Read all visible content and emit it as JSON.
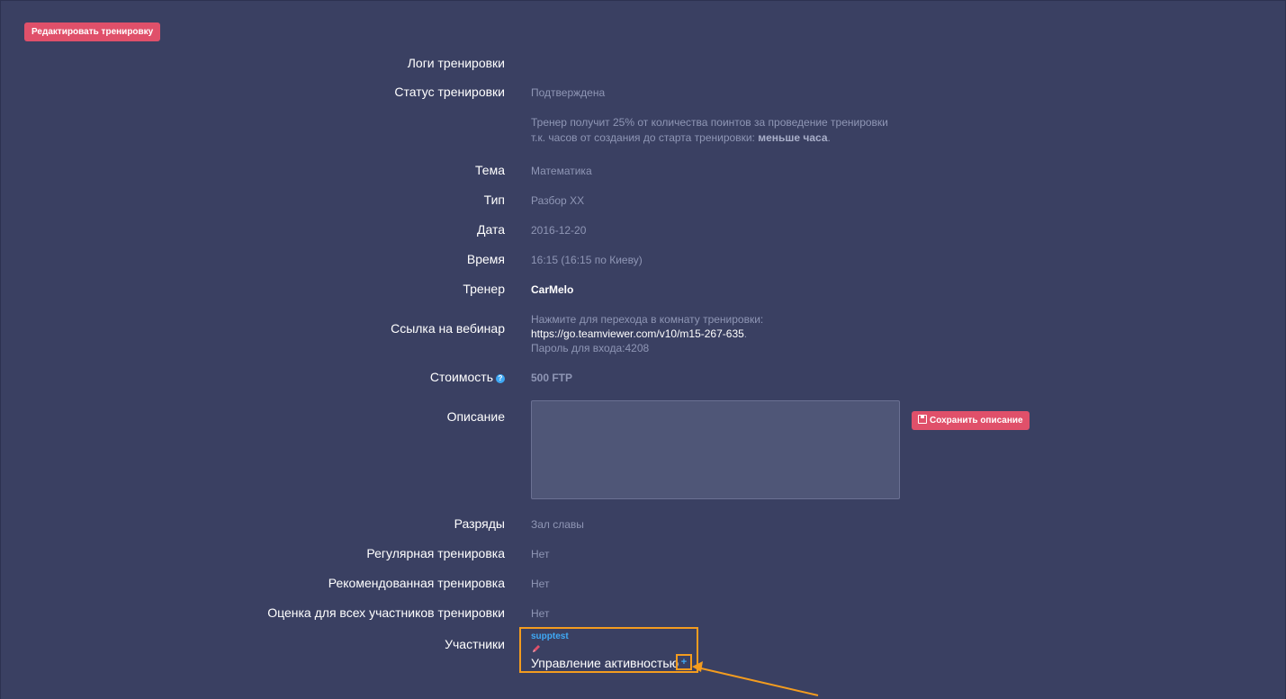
{
  "edit_button_label": "Редактировать тренировку",
  "fields": {
    "logs": {
      "label": "Логи тренировки",
      "value": ""
    },
    "status": {
      "label": "Статус тренировки",
      "value": "Подтверждена"
    },
    "status_note": {
      "line1": "Тренер получит 25% от количества поинтов за проведение тренировки",
      "line2_prefix": "т.к. часов от создания до старта тренировки: ",
      "line2_bold": "меньше часа",
      "line2_suffix": "."
    },
    "topic": {
      "label": "Тема",
      "value": "Математика"
    },
    "type": {
      "label": "Тип",
      "value": "Разбор XX"
    },
    "date": {
      "label": "Дата",
      "value": "2016-12-20"
    },
    "time": {
      "label": "Время",
      "value": "16:15 (16:15 по Киеву)"
    },
    "trainer": {
      "label": "Тренер",
      "value": "CarMelo"
    },
    "webinar": {
      "label": "Ссылка на вебинар",
      "line1": "Нажмите для перехода в комнату тренировки:",
      "link": "https://go.teamviewer.com/v10/m15-267-635",
      "link_suffix": ".",
      "password": "Пароль для входа:4208"
    },
    "cost": {
      "label": "Стоимость",
      "help_icon": "?",
      "value": "500 FTP"
    },
    "description": {
      "label": "Описание",
      "value": "",
      "save_button": "Сохранить описание"
    },
    "ranks": {
      "label": "Разряды",
      "value": "Зал славы"
    },
    "regular": {
      "label": "Регулярная тренировка",
      "value": "Нет"
    },
    "recommended": {
      "label": "Рекомендованная тренировка",
      "value": "Нет"
    },
    "rating": {
      "label": "Оценка для всех участников тренировки",
      "value": "Нет"
    },
    "participants": {
      "label": "Участники",
      "name": "supptest",
      "activity_label": "Управление активностью",
      "add_symbol": "+"
    }
  },
  "colors": {
    "background": "#3a4062",
    "accent_button": "#e0506a",
    "highlight": "#f39c1f",
    "link": "#3fa9f5"
  }
}
